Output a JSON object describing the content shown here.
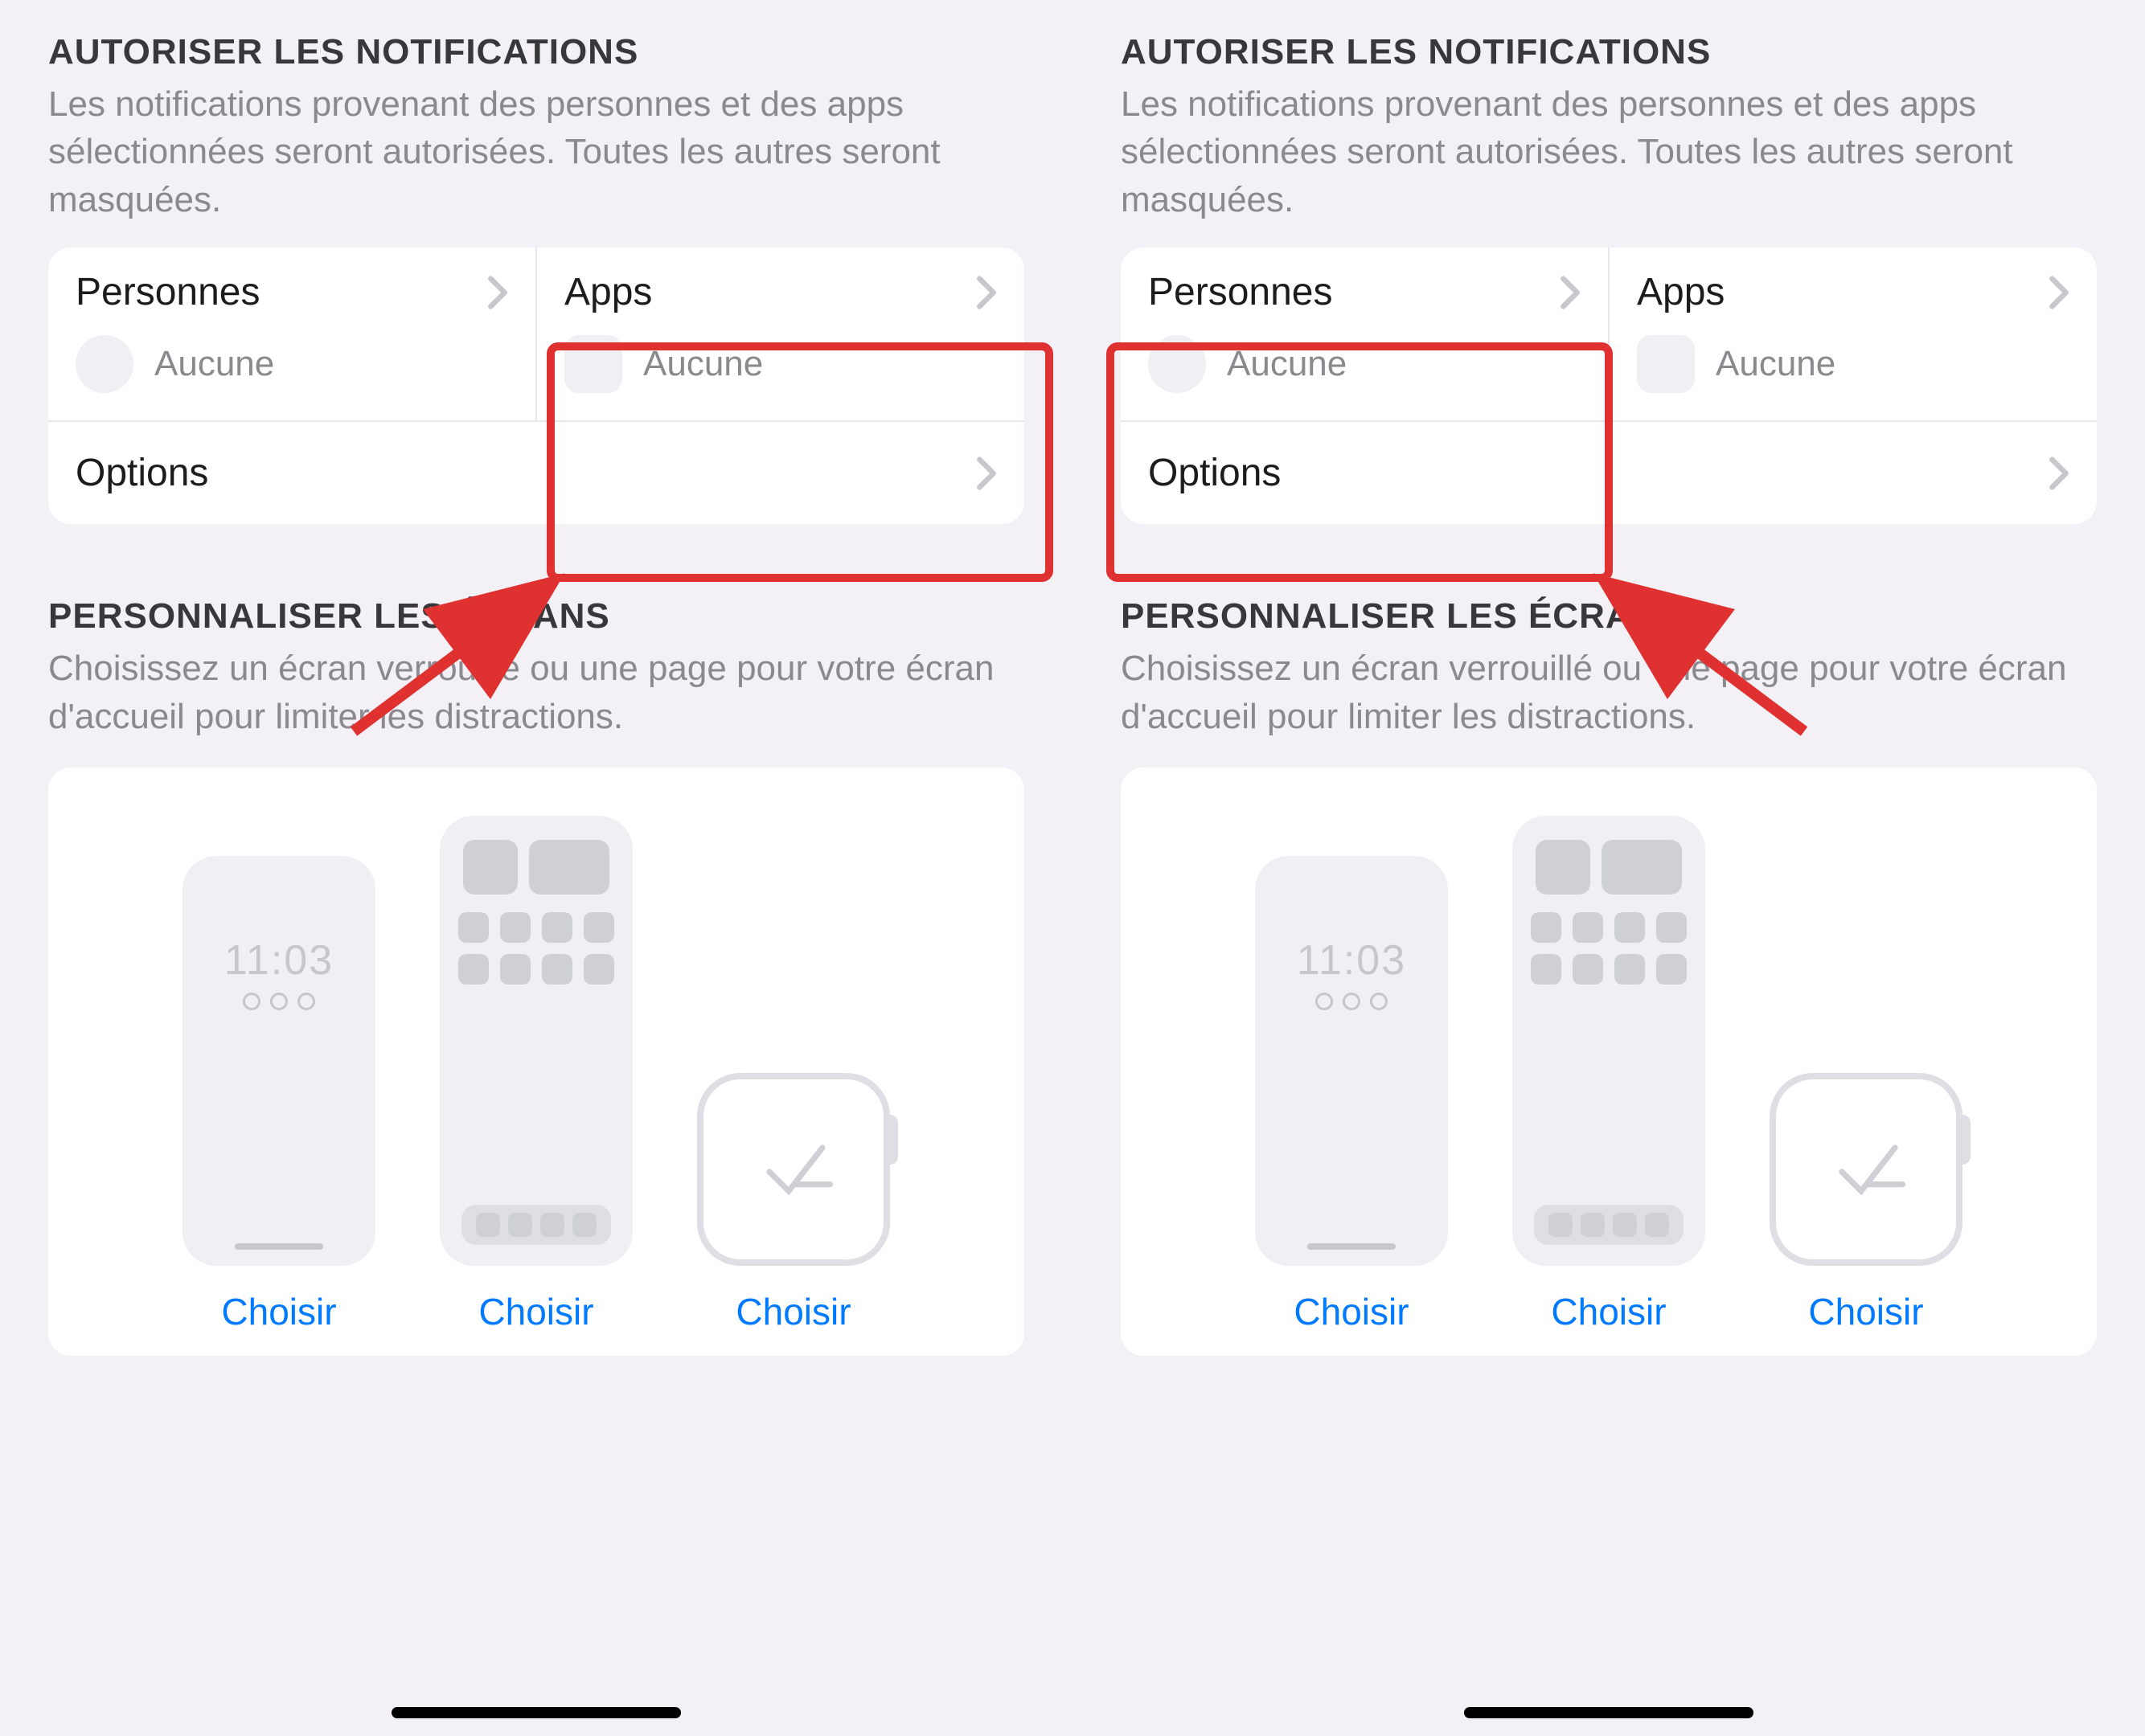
{
  "left": {
    "notif_header": "AUTORISER LES NOTIFICATIONS",
    "notif_desc": "Les notifications provenant des personnes et des apps sélectionnées seront autorisées. Toutes les autres seront masquées.",
    "personnes_label": "Personnes",
    "personnes_value": "Aucune",
    "apps_label": "Apps",
    "apps_value": "Aucune",
    "options_label": "Options",
    "screens_header": "PERSONNALISER LES ÉCRANS",
    "screens_desc": "Choisissez un écran verrouillé ou une page pour votre écran d'accueil pour limiter les distractions.",
    "lock_time": "11:03",
    "choose_label": "Choisir"
  },
  "right": {
    "notif_header": "AUTORISER LES NOTIFICATIONS",
    "notif_desc": "Les notifications provenant des personnes et des apps sélectionnées seront autorisées. Toutes les autres seront masquées.",
    "personnes_label": "Personnes",
    "personnes_value": "Aucune",
    "apps_label": "Apps",
    "apps_value": "Aucune",
    "options_label": "Options",
    "screens_header": "PERSONNALISER LES ÉCRANS",
    "screens_desc": "Choisissez un écran verrouillé ou une page pour votre écran d'accueil pour limiter les distractions.",
    "lock_time": "11:03",
    "choose_label": "Choisir"
  },
  "annotations": {
    "highlight_color": "#e03131",
    "left_highlight_target": "apps-cell",
    "right_highlight_target": "personnes-cell"
  }
}
